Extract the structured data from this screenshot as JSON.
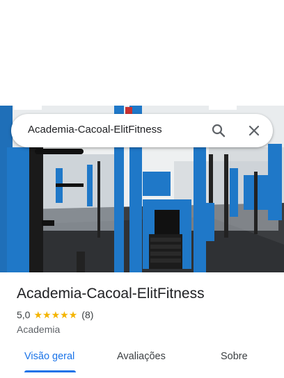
{
  "search": {
    "query": "Academia-Cacoal-ElitFitness",
    "search_icon": "search-icon",
    "close_icon": "close-icon"
  },
  "photo": {
    "subject": "gym-interior-photo"
  },
  "place": {
    "title": "Academia-Cacoal-ElitFitness",
    "rating": "5,0",
    "stars": 5,
    "star_char": "★",
    "review_count": "(8)",
    "category": "Academia"
  },
  "tabs": [
    {
      "label": "Visão geral",
      "active": true
    },
    {
      "label": "Avaliações",
      "active": false
    },
    {
      "label": "Sobre",
      "active": false
    }
  ],
  "colors": {
    "accent": "#1a73e8",
    "star": "#f4b400",
    "equipment_blue": "#1f78c8"
  }
}
